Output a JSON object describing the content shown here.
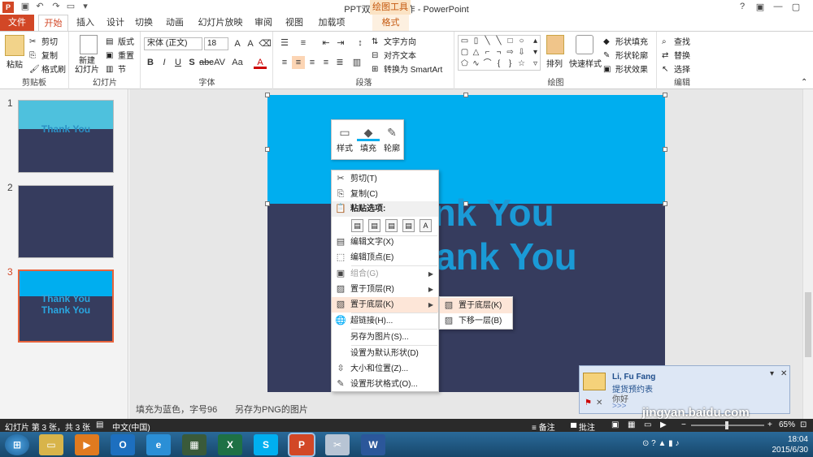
{
  "window": {
    "title": "PPT双色字的制作 - PowerPoint",
    "context_group": "绘图工具",
    "app_badge": "P"
  },
  "tabs": [
    "文件",
    "开始",
    "插入",
    "设计",
    "切换",
    "动画",
    "幻灯片放映",
    "审阅",
    "视图",
    "加载项",
    "格式"
  ],
  "ribbon": {
    "clipboard": {
      "label": "剪贴板",
      "paste": "粘贴",
      "cut": "剪切",
      "copy": "复制",
      "format_painter": "格式刷"
    },
    "slides": {
      "label": "幻灯片",
      "new_slide": "新建\n幻灯片",
      "layout": "版式",
      "reset": "重置",
      "section": "节"
    },
    "font": {
      "label": "字体",
      "font_name": "宋体 (正文)",
      "font_size": "18"
    },
    "paragraph": {
      "label": "段落",
      "text_direction": "文字方向",
      "align_text": "对齐文本",
      "smartart": "转换为 SmartArt"
    },
    "drawing": {
      "label": "绘图",
      "arrange": "排列",
      "quick_styles": "快速样式",
      "shape_fill": "形状填充",
      "shape_outline": "形状轮廓",
      "shape_effects": "形状效果"
    },
    "editing": {
      "label": "编辑",
      "find": "查找",
      "replace": "替换",
      "select": "选择"
    }
  },
  "slides_pane": [
    {
      "num": "1",
      "text": "Thank You"
    },
    {
      "num": "2",
      "text": ""
    },
    {
      "num": "3",
      "text1": "Thank You",
      "text2": "Thank You"
    }
  ],
  "slide": {
    "line1": "ank You",
    "line2": "hank You"
  },
  "mini_toolbar": {
    "style": "样式",
    "fill": "填充",
    "outline": "轮廓"
  },
  "context_menu": {
    "cut": "剪切(T)",
    "copy": "复制(C)",
    "paste_options": "粘贴选项:",
    "edit_text": "编辑文字(X)",
    "edit_points": "编辑顶点(E)",
    "group": "组合(G)",
    "bring_to_front": "置于顶层(R)",
    "send_to_back": "置于底层(K)",
    "hyperlink": "超链接(H)...",
    "save_as_picture": "另存为图片(S)...",
    "set_default": "设置为默认形状(D)",
    "size_position": "大小和位置(Z)...",
    "format_shape": "设置形状格式(O)..."
  },
  "submenu": {
    "send_to_back": "置于底层(K)",
    "send_backward": "下移一层(B)"
  },
  "notes": {
    "text1": "填充为蓝色，字号96",
    "text2": "另存为PNG的图片"
  },
  "statusbar": {
    "slide_info": "幻灯片 第 3 张，共 3 张",
    "language": "中文(中国)",
    "notes_btn": "备注",
    "comments_btn": "批注",
    "zoom": "65%"
  },
  "toast": {
    "name": "Li, Fu Fang",
    "subject": "提货预约表",
    "line": "你好",
    "arrows": ">>>"
  },
  "taskbar": {
    "time": "18:04",
    "date": "2015/6/30"
  },
  "watermark": "jingyan.baidu.com",
  "colors": {
    "accent": "#d24726",
    "slide_blue": "#00aeef",
    "slide_navy": "#363c5e"
  }
}
